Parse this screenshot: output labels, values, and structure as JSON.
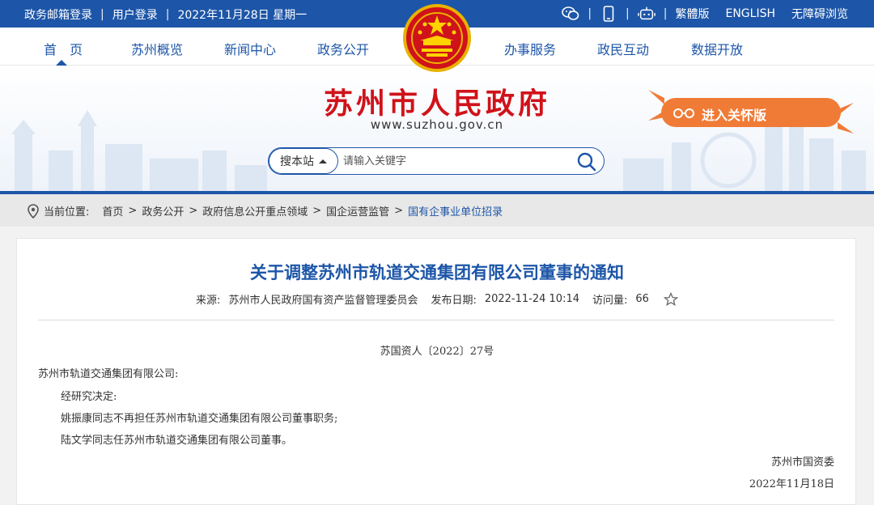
{
  "topbar": {
    "links": [
      "政务邮箱登录",
      "用户登录"
    ],
    "date": "2022年11月28日 星期一",
    "right_links": [
      "繁體版",
      "ENGLISH",
      "无障碍浏览"
    ],
    "icons": [
      "wechat-icon",
      "mobile-icon",
      "robot-icon"
    ]
  },
  "nav": {
    "items": [
      "首　页",
      "苏州概览",
      "新闻中心",
      "政务公开",
      "办事服务",
      "政民互动",
      "数据开放"
    ]
  },
  "banner": {
    "site_name": "苏州市人民政府",
    "site_url": "www.suzhou.gov.cn",
    "care_button": "进入关怀版"
  },
  "search": {
    "scope": "搜本站",
    "placeholder": "请输入关键字"
  },
  "breadcrumb": {
    "label": "当前位置:",
    "items": [
      "首页",
      "政务公开",
      "政府信息公开重点领域",
      "国企运营监管",
      "国有企事业单位招录"
    ]
  },
  "article": {
    "title": "关于调整苏州市轨道交通集团有限公司董事的通知",
    "meta": {
      "source_label": "来源:",
      "source": "苏州市人民政府国有资产监督管理委员会",
      "date_label": "发布日期:",
      "date": "2022-11-24 10:14",
      "views_label": "访问量:",
      "views": "66"
    },
    "doc_number": "苏国资人〔2022〕27号",
    "addressee": "苏州市轨道交通集团有限公司:",
    "paragraphs": [
      "经研究决定:",
      "姚振康同志不再担任苏州市轨道交通集团有限公司董事职务;",
      "陆文学同志任苏州市轨道交通集团有限公司董事。"
    ],
    "signature": "苏州市国资委",
    "sign_date": "2022年11月18日"
  },
  "colors": {
    "primary": "#1d56a8",
    "red": "#d0121a",
    "orange": "#f07b36"
  }
}
